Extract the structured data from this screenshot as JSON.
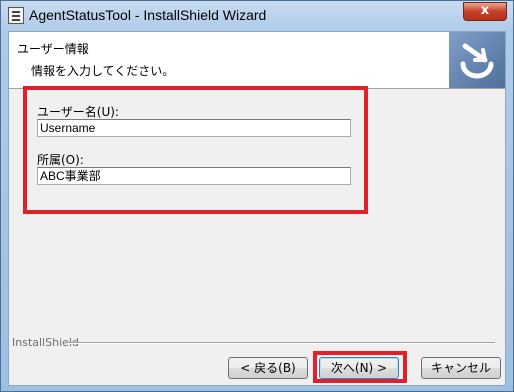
{
  "window": {
    "title": "AgentStatusTool - InstallShield Wizard",
    "close_label": "x"
  },
  "header": {
    "title": "ユーザー情報",
    "subtitle": "情報を入力してください。",
    "logo_icon": "installshield-logo-icon"
  },
  "form": {
    "username_label": "ユーザー名(U):",
    "username_value": "Username",
    "organization_label": "所属(O):",
    "organization_value": "ABC事業部"
  },
  "footer": {
    "brand": "InstallShield",
    "back_label": "< 戻る(B)",
    "next_label": "次へ(N) >",
    "cancel_label": "キャンセル"
  },
  "colors": {
    "highlight": "#e0212b",
    "titlebar": "#aecbe9",
    "dialog": "#f0f0f0"
  }
}
